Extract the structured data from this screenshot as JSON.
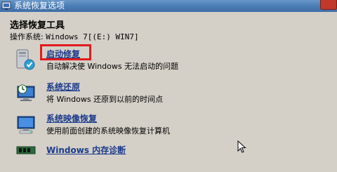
{
  "window": {
    "title": "系统恢复选项"
  },
  "header": {
    "heading": "选择恢复工具",
    "os_label": "操作系统: ",
    "os_value": "Windows 7[(E:) WIN7]"
  },
  "tools": [
    {
      "title": "启动修复",
      "description": "自动解决使 Windows 无法启动的问题",
      "icon": "startup-repair-icon"
    },
    {
      "title": "系统还原",
      "description": "将 Windows 还原到以前的时间点",
      "icon": "system-restore-icon"
    },
    {
      "title": "系统映像恢复",
      "description": "使用前面创建的系统映像恢复计算机",
      "icon": "system-image-recovery-icon"
    },
    {
      "title": "Windows 内存诊断",
      "description": "",
      "icon": "memory-diagnostic-icon"
    }
  ],
  "colors": {
    "background": "#d4d0c8",
    "link": "#1a3a8c",
    "highlight": "#e21b1b",
    "titlebar": "#4d7fb7"
  }
}
